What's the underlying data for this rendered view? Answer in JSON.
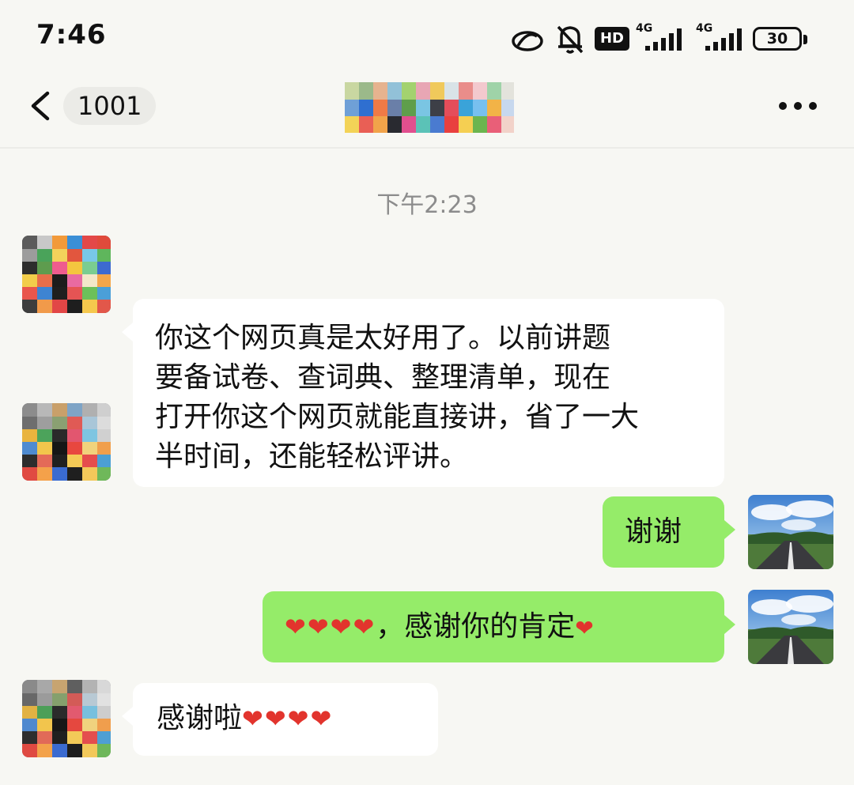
{
  "status_bar": {
    "time": "7:46",
    "hd_label": "HD",
    "network_1": "4G",
    "network_2": "4G",
    "battery_level": "30",
    "icons": [
      "eye-protect-icon",
      "bell-muted-icon",
      "hd-call-icon",
      "signal-icon",
      "signal-icon",
      "battery-icon"
    ]
  },
  "nav_bar": {
    "unread_count": "1001",
    "icons": [
      "back-chevron-icon",
      "more-icon"
    ]
  },
  "chat": {
    "timestamp": "下午2:23",
    "messages": [
      {
        "direction": "incoming",
        "lines": [
          "你这个网页真是太好用了。以前讲题",
          "要备试卷、查词典、整理清单，现在",
          "打开你这个网页就能直接讲，省了一大",
          "半时间，还能轻松评讲。"
        ]
      },
      {
        "direction": "outgoing",
        "text": "谢谢"
      },
      {
        "direction": "outgoing",
        "hearts": "❤❤❤❤",
        "text": "，感谢你的肯定",
        "trailing_heart": "❤"
      },
      {
        "direction": "incoming",
        "text": "感谢啦",
        "hearts": "❤❤❤❤"
      }
    ]
  },
  "colors": {
    "background": "#f7f7f3",
    "incoming_bubble": "#ffffff",
    "outgoing_bubble": "#95ec69",
    "heart": "#e2342d",
    "timestamp_text": "#8c8c8c"
  }
}
